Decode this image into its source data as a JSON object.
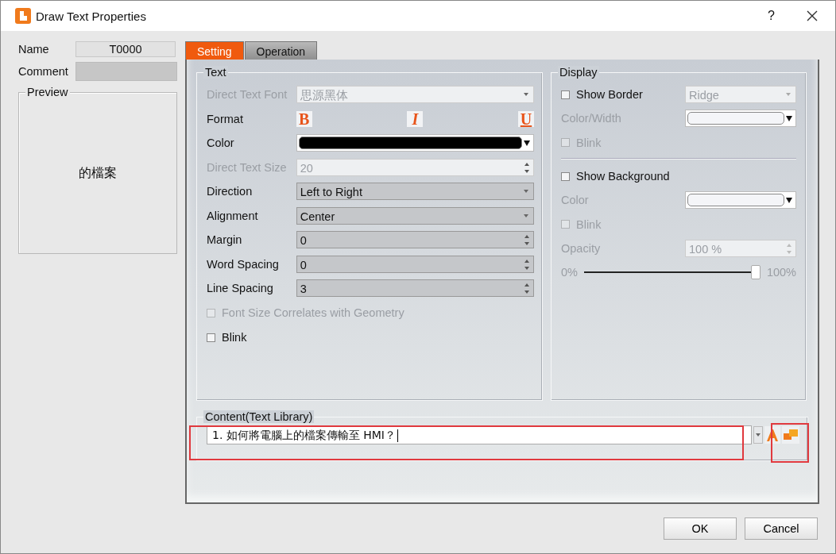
{
  "window": {
    "title": "Draw Text Properties",
    "help": "?"
  },
  "name": {
    "label": "Name",
    "value": "T0000"
  },
  "comment": {
    "label": "Comment"
  },
  "preview": {
    "title": "Preview",
    "text": "的檔案"
  },
  "tabs": [
    {
      "label": "Setting",
      "selected": true
    },
    {
      "label": "Operation",
      "selected": false
    }
  ],
  "text_group": {
    "title": "Text",
    "rows": [
      {
        "kind": "select",
        "label": "Direct Text Font",
        "value": "思源黑体",
        "disabled": true
      },
      {
        "kind": "format",
        "label": "Format",
        "buttons": [
          "B",
          "I",
          "U"
        ],
        "disabled": false
      },
      {
        "kind": "color",
        "label": "Color",
        "color": "#000000",
        "disabled": false
      },
      {
        "kind": "spin",
        "label": "Direct Text Size",
        "value": "20",
        "disabled": true
      },
      {
        "kind": "select",
        "label": "Direction",
        "value": "Left to Right",
        "disabled": false
      },
      {
        "kind": "select",
        "label": "Alignment",
        "value": "Center",
        "disabled": false
      },
      {
        "kind": "spin",
        "label": "Margin",
        "value": "0",
        "disabled": false
      },
      {
        "kind": "spin",
        "label": "Word Spacing",
        "value": "0",
        "disabled": false
      },
      {
        "kind": "spin",
        "label": "Line Spacing",
        "value": "3",
        "disabled": false
      },
      {
        "kind": "checkbox",
        "label": "Font Size Correlates with Geometry",
        "checked": false,
        "disabled": true
      },
      {
        "kind": "checkbox",
        "label": "Blink",
        "checked": false,
        "disabled": false
      }
    ]
  },
  "display_group": {
    "title": "Display",
    "rows": [
      {
        "kind": "checkselect",
        "label": "Show Border",
        "checked": false,
        "value": "Ridge",
        "disabled": false
      },
      {
        "kind": "color",
        "label": "Color/Width",
        "color": "#f4f5f8",
        "disabled": true
      },
      {
        "kind": "checkbox",
        "label": "Blink",
        "checked": false,
        "disabled": true
      },
      {
        "kind": "divider"
      },
      {
        "kind": "checkbox",
        "label": "Show Background",
        "checked": false,
        "disabled": false
      },
      {
        "kind": "color",
        "label": "Color",
        "color": "#f4f5f8",
        "disabled": true
      },
      {
        "kind": "checkbox",
        "label": "Blink",
        "checked": false,
        "disabled": true
      },
      {
        "kind": "spin",
        "label": "Opacity",
        "value": "100 %",
        "disabled": true
      },
      {
        "kind": "slider",
        "min_label": "0%",
        "max_label": "100%",
        "level": 1,
        "disabled": true
      }
    ]
  },
  "content": {
    "title": "Content(Text Library)",
    "value": "1. 如何將電腦上的檔案傳輸至 HMI？"
  },
  "buttons": [
    "OK",
    "Cancel"
  ]
}
